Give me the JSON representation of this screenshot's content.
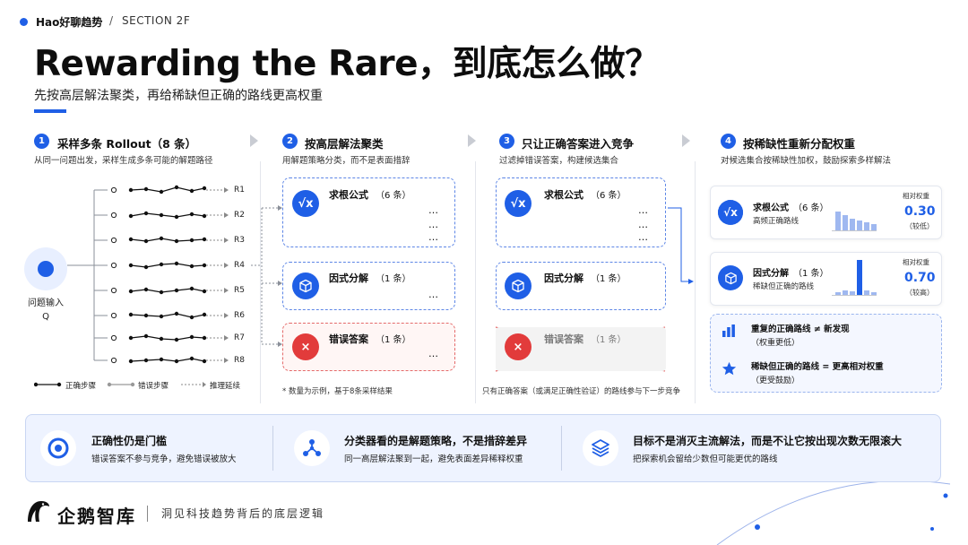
{
  "header": {
    "brand": "Hao好聊趋势",
    "separator": "/",
    "section": "SECTION 2F"
  },
  "title": "Rewarding the Rare，到底怎么做？",
  "subtitle": "先按高层解法聚类，再给稀缺但正确的路线更高权重",
  "steps": [
    {
      "num": "1",
      "title": "采样多条 Rollout（8 条）",
      "desc": "从同一问题出发，采样生成多条可能的解题路径"
    },
    {
      "num": "2",
      "title": "按高层解法聚类",
      "desc": "用解题策略分类，而不是表面措辞"
    },
    {
      "num": "3",
      "title": "只让正确答案进入竞争",
      "desc": "过滤掉错误答案，构建候选集合"
    },
    {
      "num": "4",
      "title": "按稀缺性重新分配权重",
      "desc": "对候选集合按稀缺性加权，鼓励探索多样解法"
    }
  ],
  "question": {
    "label": "问题输入",
    "symbol": "Q"
  },
  "rollouts": [
    "R1",
    "R2",
    "R3",
    "R4",
    "R5",
    "R6",
    "R7",
    "R8"
  ],
  "legend": {
    "correct": "正确步骤",
    "wrong": "错误步骤",
    "extend": "推理延续"
  },
  "clusters": [
    {
      "icon": "√x",
      "name": "求根公式",
      "count": "（6 条）"
    },
    {
      "icon": "cube",
      "name": "因式分解",
      "count": "（1 条）"
    },
    {
      "icon": "×",
      "name": "错误答案",
      "count": "（1 条）"
    }
  ],
  "ellipsis": "…",
  "note2": "* 数量为示例，基于8条采样结果",
  "note3": "只有正确答案（或满足正确性验证）的路线参与下一步竞争",
  "weights": [
    {
      "name": "求根公式",
      "count": "（6 条）",
      "sub": "高频正确路线",
      "rlabel": "相对权重",
      "value": "0.30",
      "paren": "（较低）"
    },
    {
      "name": "因式分解",
      "count": "（1 条）",
      "sub": "稀缺但正确的路线",
      "rlabel": "相对权重",
      "value": "0.70",
      "paren": "（较高）"
    }
  ],
  "summary": [
    {
      "left": "重复的正确路线",
      "op": "≠",
      "right": "新发现",
      "sub": "（权重更低）"
    },
    {
      "left": "稀缺但正确的路线",
      "op": "=",
      "right": "更高相对权重",
      "sub": "（更受鼓励）"
    }
  ],
  "banner": [
    {
      "title": "正确性仍是门槛",
      "sub": "错误答案不参与竞争，避免错误被放大"
    },
    {
      "title": "分类器看的是解题策略，不是措辞差异",
      "sub": "同一高层解法聚到一起，避免表面差异稀释权重"
    },
    {
      "title": "目标不是消灭主流解法，而是不让它按出现次数无限滚大",
      "sub": "把探索机会留给少数但可能更优的路线"
    }
  ],
  "footer": {
    "logo": "企鹅智库",
    "tagline": "洞见科技趋势背后的底层逻辑"
  },
  "colors": {
    "accent": "#1f5fe6",
    "error": "#e23b3b"
  }
}
